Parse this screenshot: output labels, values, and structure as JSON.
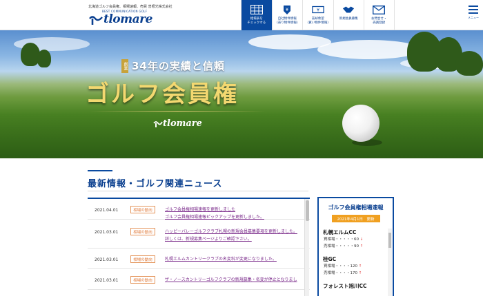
{
  "header": {
    "tagline": "北海道ゴルフ会員権、相場速報、売買 曽根光株式会社",
    "sub_brand": "BEST COMMUNICATION GOLF",
    "logo_text": "tlomare",
    "nav": [
      {
        "label": "相場表を\nチェックする",
        "icon": "table-icon",
        "active": true
      },
      {
        "label": "自社物件情報\n(売り物件情報)",
        "icon": "tag-yen-icon",
        "active": false
      },
      {
        "label": "売却希望\n(買い物件情報)",
        "icon": "banknote-icon",
        "active": false
      },
      {
        "label": "新規会員募集",
        "icon": "handshake-icon",
        "active": false
      },
      {
        "label": "お問合せ・\n売買登録",
        "icon": "mail-icon",
        "active": false
      }
    ],
    "menu_label": "メニュー"
  },
  "hero": {
    "badge": "創業",
    "line1": "34年の実績と信頼",
    "title": "ゴルフ会員権",
    "logo_text": "tlomare"
  },
  "news": {
    "title": "最新情報・ゴルフ関連ニュース",
    "items": [
      {
        "date": "2021.04.01",
        "category": "相場の動向",
        "text": "ゴルフ会員権相場速報を更新しました\nゴルフ会員権相場速報ピックアップを更新しました。"
      },
      {
        "date": "2021.03.01",
        "category": "相場の動向",
        "text": "ハッピーバレーゴルフクラブ札幌の新規会員募集要項を更新しました。詳しくは、新規募集ページよりご確認下さい。"
      },
      {
        "date": "2021.03.01",
        "category": "相場の動向",
        "text": "札幌エルムカントリークラブの名変料が変更になりました。"
      },
      {
        "date": "2021.03.01",
        "category": "相場の動向",
        "text": "ザ・ノースカントリーゴルフクラブの新規募集・名変が停止となりまし"
      }
    ]
  },
  "quote": {
    "title": "ゴルフ会員権相場速報",
    "date": "2021年4月1日　更新",
    "courses": [
      {
        "name": "札幌エルムCC",
        "buy": "買相場・・・・・60",
        "buy_arrow": "↓",
        "sell": "売相場・・・・・90",
        "sell_arrow": "↑"
      },
      {
        "name": "桂GC",
        "buy": "買相場・・・・120",
        "buy_arrow": "↑",
        "sell": "売相場・・・・170",
        "sell_arrow": "↑"
      },
      {
        "name": "フォレスト旭川CC",
        "buy": "",
        "buy_arrow": "",
        "sell": "",
        "sell_arrow": ""
      }
    ]
  },
  "colors": {
    "brand_blue": "#0a4aa0",
    "accent_orange": "#f0a021",
    "category_orange": "#e07a3a",
    "link_purple": "#7a2a8a",
    "hero_gold": "#f3d870",
    "up_red": "#e03a3a"
  }
}
